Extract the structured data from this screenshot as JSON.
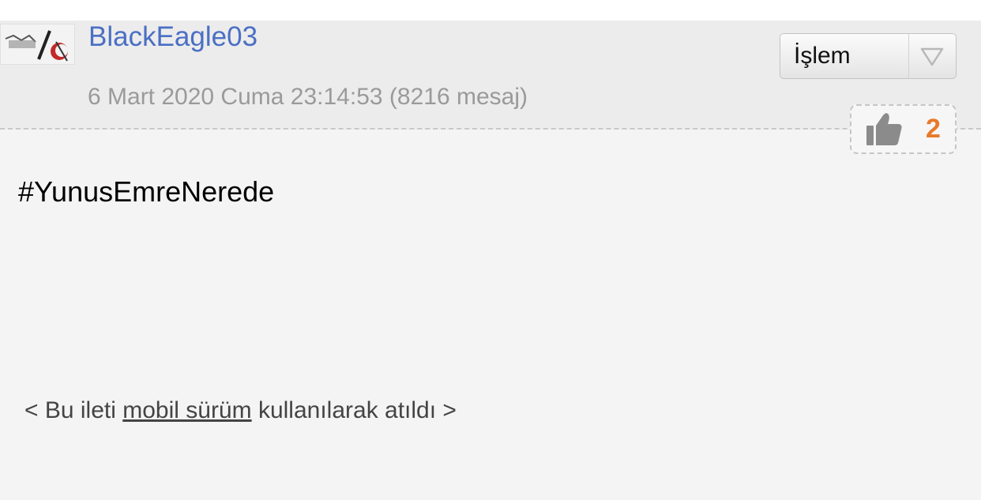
{
  "post": {
    "username": "BlackEagle03",
    "date": "6 Mart 2020 Cuma 23:14:53",
    "post_count": "(8216 mesaj)",
    "action_label": "İşlem",
    "like_count": "2",
    "message": "#YunusEmreNerede"
  },
  "footer": {
    "prefix": "< Bu ileti ",
    "link_text": "mobil sürüm",
    "suffix": " kullanılarak atıldı >"
  },
  "icons": {
    "avatar": "user-avatar-image",
    "dropdown": "chevron-down-icon",
    "like": "thumbs-up-icon"
  },
  "colors": {
    "username": "#4a6fc4",
    "like_count": "#e8792a",
    "meta": "#9a9a9a"
  }
}
